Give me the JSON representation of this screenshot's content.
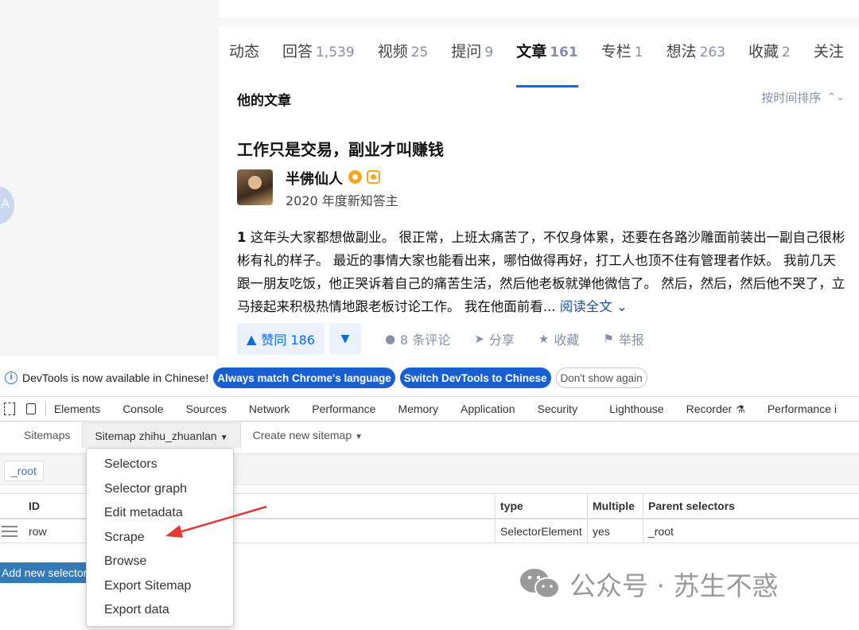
{
  "zhihu": {
    "left_avatar_letter": "A",
    "tabs": [
      {
        "label": "动态",
        "count": ""
      },
      {
        "label": "回答",
        "count": "1,539"
      },
      {
        "label": "视频",
        "count": "25"
      },
      {
        "label": "提问",
        "count": "9"
      },
      {
        "label": "文章",
        "count": "161"
      },
      {
        "label": "专栏",
        "count": "1"
      },
      {
        "label": "想法",
        "count": "263"
      },
      {
        "label": "收藏",
        "count": "2"
      },
      {
        "label": "关注",
        "count": ""
      }
    ],
    "active_tab": "文章",
    "section_title": "他的文章",
    "sort_label": "按时间排序",
    "article": {
      "title": "工作只是交易，副业才叫赚钱",
      "author_name": "半佛仙人",
      "author_sub": "2020 年度新知答主",
      "excerpt_num": "1",
      "excerpt": " 这年头大家都想做副业。 很正常，上班太痛苦了，不仅身体累，还要在各路沙雕面前装出一副自己很彬彬有礼的样子。 最近的事情大家也能看出来，哪怕做得再好，打工人也顶不住有管理者作妖。 我前几天跟一朋友吃饭，他正哭诉着自己的痛苦生活，然后他老板就弹他微信了。 然后，然后，然后他不哭了，立马接起来积极热情地跟老板讨论工作。 我在他面前看...",
      "read_more": "阅读全文"
    },
    "actions": {
      "vote": "赞同 186",
      "comments": "8 条评论",
      "share": "分享",
      "collect": "收藏",
      "report": "举报"
    }
  },
  "devtools": {
    "info_message": "DevTools is now available in Chinese!",
    "btn_match": "Always match Chrome's language",
    "btn_switch": "Switch DevTools to Chinese",
    "btn_dismiss": "Don't show again",
    "tabs": [
      "Elements",
      "Console",
      "Sources",
      "Network",
      "Performance",
      "Memory",
      "Application",
      "Security",
      "Lighthouse",
      "Recorder",
      "Performance i"
    ]
  },
  "webscraper": {
    "nav": {
      "sitemaps": "Sitemaps",
      "current_sitemap": "Sitemap zhihu_zhuanlan",
      "create": "Create new sitemap"
    },
    "breadcrumb": "_root",
    "table": {
      "headers": {
        "id": "ID",
        "type": "type",
        "multiple": "Multiple",
        "parents": "Parent selectors"
      },
      "rows": [
        {
          "id": "row",
          "type": "SelectorElement",
          "multiple": "yes",
          "parents": "_root"
        }
      ]
    },
    "add_selector": "Add new selector",
    "menu": [
      "Selectors",
      "Selector graph",
      "Edit metadata",
      "Scrape",
      "Browse",
      "Export Sitemap",
      "Export data"
    ]
  },
  "watermark": "公众号 · 苏生不惑",
  "colors": {
    "zhihu_blue": "#056de8",
    "devtools_blue": "#1a5fd0",
    "link_blue": "#337ab7",
    "arrow_red": "#e53935"
  }
}
